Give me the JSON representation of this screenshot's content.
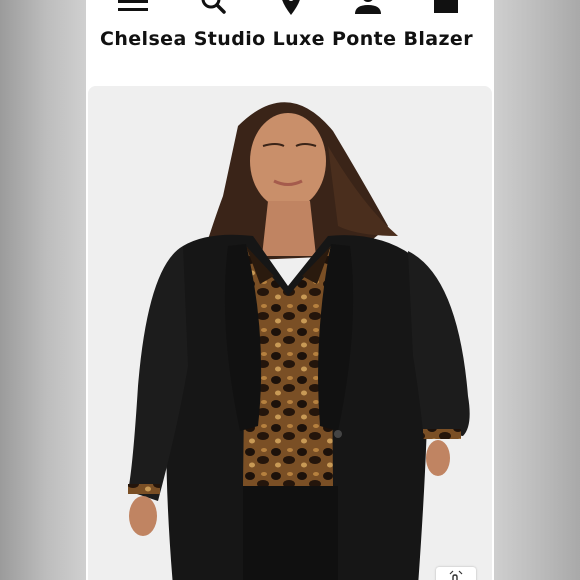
{
  "nav": {
    "icons": [
      "menu-icon",
      "search-icon",
      "location-pin-icon",
      "account-icon",
      "bag-icon"
    ]
  },
  "product": {
    "title": "Chelsea Studio Luxe Ponte Blazer",
    "image_alt": "Model wearing the black ponte blazer over a leopard print blouse"
  },
  "colors": {
    "background": "#ffffff",
    "text": "#111111",
    "photo_background": "#efefef",
    "blazer": "#161616",
    "blouse": "#3b2414"
  }
}
